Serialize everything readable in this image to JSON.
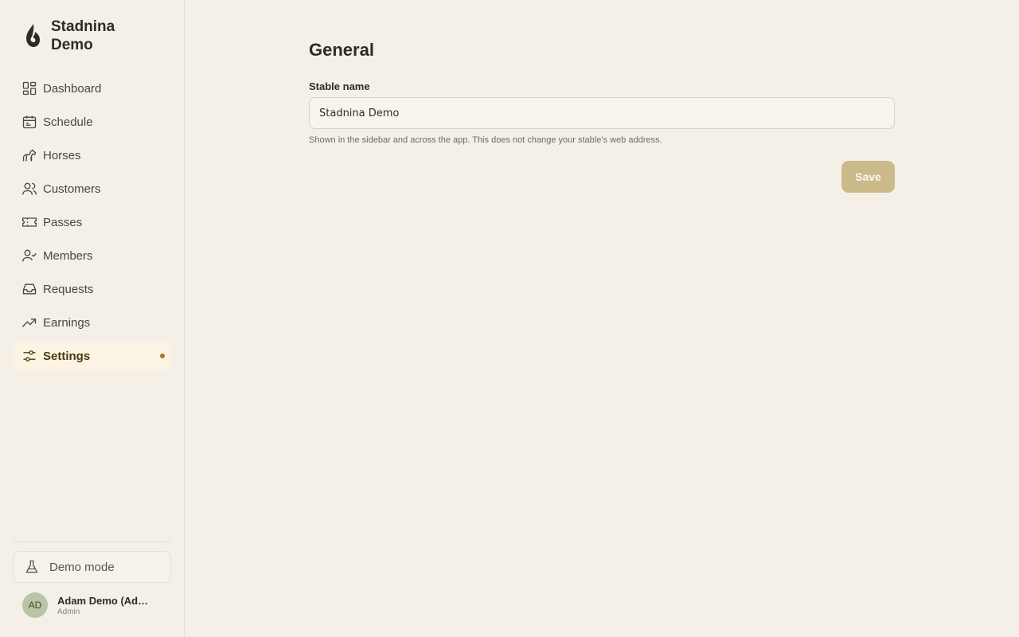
{
  "brand": {
    "name": "Stadnina Demo"
  },
  "nav": [
    {
      "label": "Dashboard",
      "icon": "dashboard-icon"
    },
    {
      "label": "Schedule",
      "icon": "calendar-icon"
    },
    {
      "label": "Horses",
      "icon": "horse-icon"
    },
    {
      "label": "Customers",
      "icon": "users-icon"
    },
    {
      "label": "Passes",
      "icon": "ticket-icon"
    },
    {
      "label": "Members",
      "icon": "user-check-icon"
    },
    {
      "label": "Requests",
      "icon": "inbox-icon"
    },
    {
      "label": "Earnings",
      "icon": "trending-up-icon"
    },
    {
      "label": "Settings",
      "icon": "sliders-icon",
      "active": true
    }
  ],
  "sidebar_footer": {
    "demo_mode_label": "Demo mode",
    "user": {
      "initials": "AD",
      "name": "Adam Demo (Admin)",
      "role": "Admin"
    }
  },
  "main": {
    "title": "General",
    "stable_name": {
      "label": "Stable name",
      "value": "Stadnina Demo",
      "help": "Shown in the sidebar and across the app. This does not change your stable’s web address."
    },
    "save_label": "Save"
  },
  "colors": {
    "background": "#f4f0e8",
    "active_nav_bg": "#fbf4e4",
    "accent_dot": "#a07a22",
    "save_button": "#cbb98a",
    "avatar_bg": "#b9c4a6"
  }
}
